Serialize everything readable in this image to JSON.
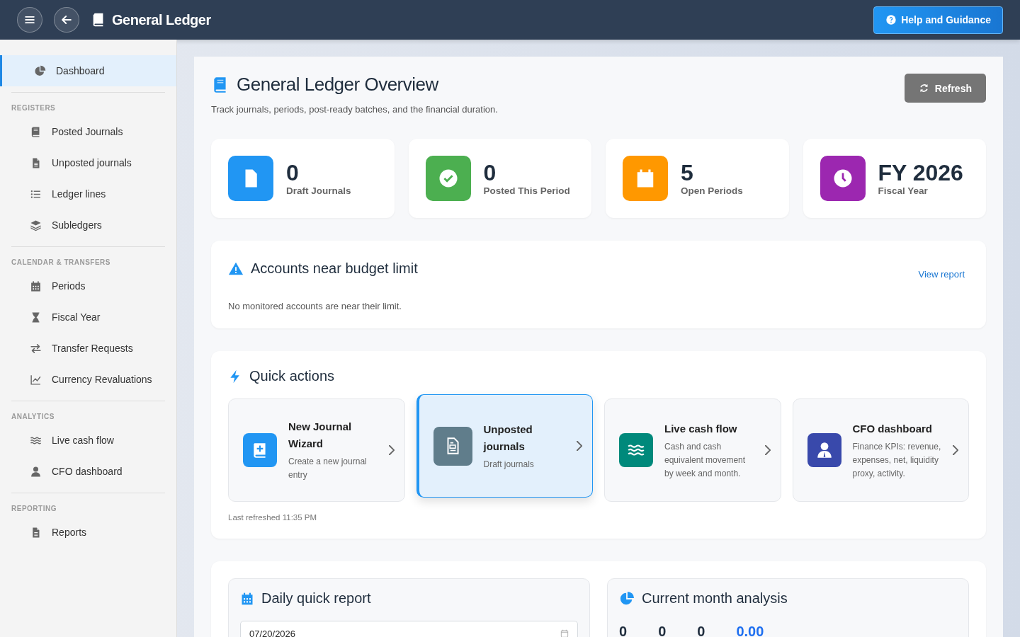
{
  "header": {
    "title": "General Ledger",
    "help_button": "Help and Guidance"
  },
  "sidebar": {
    "sections": [
      {
        "items": [
          {
            "label": "Dashboard",
            "selected": true
          }
        ]
      },
      {
        "title": "REGISTERS",
        "items": [
          {
            "label": "Posted Journals",
            "selected": false
          },
          {
            "label": "Unposted journals",
            "selected": false
          },
          {
            "label": "Ledger lines",
            "selected": false
          },
          {
            "label": "Subledgers",
            "selected": false
          }
        ]
      },
      {
        "title": "CALENDAR & TRANSFERS",
        "items": [
          {
            "label": "Periods",
            "selected": false
          },
          {
            "label": "Fiscal Year",
            "selected": false
          },
          {
            "label": "Transfer Requests",
            "selected": false
          },
          {
            "label": "Currency Revaluations",
            "selected": false
          }
        ]
      },
      {
        "title": "ANALYTICS",
        "items": [
          {
            "label": "Live cash flow",
            "selected": false
          },
          {
            "label": "CFO dashboard",
            "selected": false
          }
        ]
      },
      {
        "title": "REPORTING",
        "items": [
          {
            "label": "Reports",
            "selected": false
          }
        ]
      }
    ]
  },
  "page": {
    "title": "General Ledger Overview",
    "subtitle": "Track journals, periods, post-ready batches, and the financial duration.",
    "refresh_button": "Refresh"
  },
  "stats": [
    {
      "value": "0",
      "label": "Draft Journals",
      "color": "#2196f3"
    },
    {
      "value": "0",
      "label": "Posted This Period",
      "color": "#4caf50"
    },
    {
      "value": "5",
      "label": "Open Periods",
      "color": "#ff9800"
    },
    {
      "value": "FY 2026",
      "label": "Fiscal Year",
      "color": "#9c27b0"
    }
  ],
  "budget": {
    "title": "Accounts near budget limit",
    "link": "View report",
    "message": "No monitored accounts are near their limit."
  },
  "quick_actions": {
    "title": "Quick actions",
    "items": [
      {
        "title": "New Journal Wizard",
        "description": "Create a new journal entry",
        "color": "#2196f3",
        "selected": false
      },
      {
        "title": "Unposted journals",
        "description": "Draft journals",
        "color": "#607d8b",
        "selected": true
      },
      {
        "title": "Live cash flow",
        "description": "Cash and cash equivalent movement by week and month.",
        "color": "#00897b",
        "selected": false
      },
      {
        "title": "CFO dashboard",
        "description": "Finance KPIs: revenue, expenses, net, liquidity proxy, activity.",
        "color": "#3949ab",
        "selected": false
      }
    ],
    "last_refreshed": "Last refreshed 11:35 PM"
  },
  "daily_report": {
    "title": "Daily quick report",
    "date": "07/20/2026"
  },
  "month_analysis": {
    "title": "Current month analysis",
    "figures": [
      {
        "value": "0",
        "kind": "count"
      },
      {
        "value": "0",
        "kind": "count"
      },
      {
        "value": "0",
        "kind": "count"
      },
      {
        "value": "0.00",
        "kind": "amount"
      }
    ]
  }
}
